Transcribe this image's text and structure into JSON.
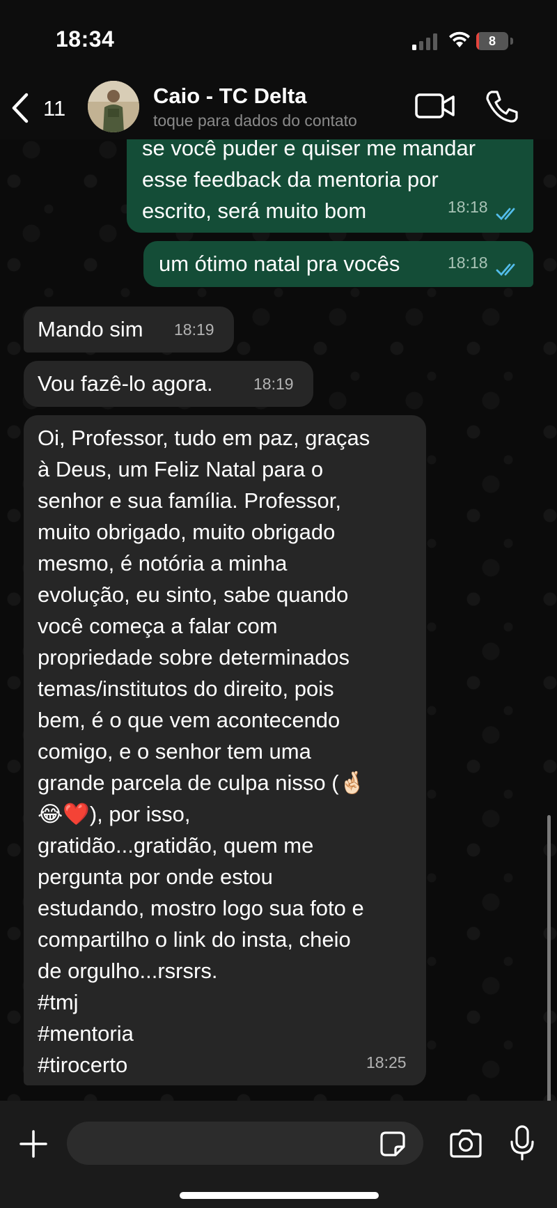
{
  "status_bar": {
    "time": "18:34",
    "battery_level": "8",
    "battery_fraction": 0.08
  },
  "header": {
    "back_count": "11",
    "contact_name": "Caio - TC Delta",
    "contact_subtitle": "toque para dados do contato"
  },
  "messages": [
    {
      "direction": "outgoing",
      "text": "se você puder e quiser me mandar\nesse feedback da mentoria por\nescrito, será muito bom",
      "time": "18:18",
      "status": "read"
    },
    {
      "direction": "outgoing",
      "text": "um ótimo natal pra vocês",
      "time": "18:18",
      "status": "read"
    },
    {
      "direction": "incoming",
      "text": "Mando sim",
      "time": "18:19"
    },
    {
      "direction": "incoming",
      "text": "Vou fazê-lo agora.",
      "time": "18:19"
    },
    {
      "direction": "incoming",
      "text": "Oi, Professor, tudo em paz, graças\nà Deus, um Feliz Natal para o\nsenhor e sua família. Professor,\nmuito obrigado, muito obrigado\nmesmo, é notória a minha\nevolução, eu sinto, sabe quando\nvocê começa a falar com\npropriedade sobre determinados\ntemas/institutos do direito, pois\nbem, é o que vem acontecendo\ncomigo, e o senhor tem uma\ngrande parcela de culpa nisso (🤞🏻\n😂❤️), por isso,\ngratidão...gratidão, quem me\npergunta por onde estou\nestudando, mostro logo sua foto e\ncompartilho o link do insta, cheio\nde orgulho...rsrsrs.\n#tmj\n#mentoria\n#tirocerto",
      "time": "18:25"
    }
  ],
  "composer": {
    "input_value": ""
  },
  "colors": {
    "outgoing_bubble": "#144d37",
    "incoming_bubble": "#262626",
    "read_ticks": "#53bdeb",
    "battery_low": "#e5453d"
  },
  "icons": [
    "back-chevron-icon",
    "video-call-icon",
    "phone-icon",
    "plus-icon",
    "sticker-icon",
    "camera-icon",
    "microphone-icon",
    "read-receipt-icon"
  ]
}
